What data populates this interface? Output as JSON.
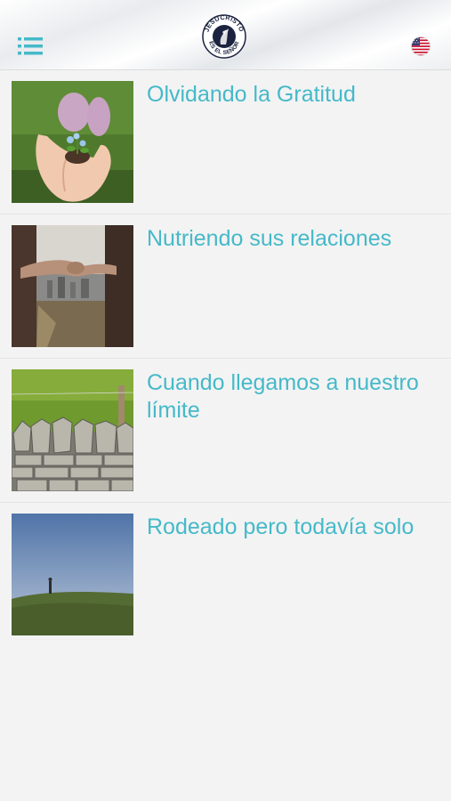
{
  "header": {
    "menu_icon": "list-icon",
    "logo": {
      "text_top": "JESUCRISTO",
      "text_bottom": "ES EL SEÑOR"
    },
    "language_icon": "us-flag-icon"
  },
  "articles": [
    {
      "title": "Olvidando la Gratitud",
      "thumbnail": "hands-holding-seedling"
    },
    {
      "title": "Nutriendo sus relaciones",
      "thumbnail": "hands-joined-city"
    },
    {
      "title": "Cuando llegamos a nuestro límite",
      "thumbnail": "stone-wall-field"
    },
    {
      "title": "Rodeado pero todavía solo",
      "thumbnail": "person-on-hill"
    }
  ],
  "colors": {
    "accent": "#45b9c9",
    "background": "#f3f3f3"
  }
}
